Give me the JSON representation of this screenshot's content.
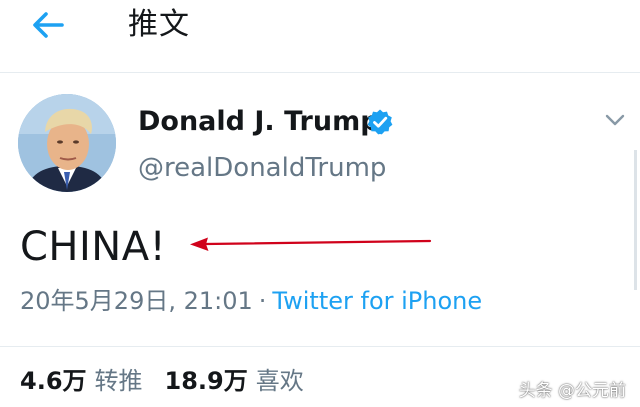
{
  "header": {
    "title": "推文",
    "back_icon": "arrow-left-icon"
  },
  "tweet": {
    "author_name": "Donald J. Trump",
    "author_handle": "@realDonaldTrump",
    "verified": true,
    "text": "CHINA!",
    "timestamp": "20年5月29日, 21:01",
    "separator": "·",
    "source": "Twitter for iPhone"
  },
  "stats": {
    "retweets_count": "4.6万",
    "retweets_label": "转推",
    "likes_count": "18.9万",
    "likes_label": "喜欢"
  },
  "watermark": "头条 @公元前",
  "colors": {
    "link_blue": "#1da1f2",
    "muted_gray": "#657786",
    "annotation_red": "#d0021b"
  }
}
